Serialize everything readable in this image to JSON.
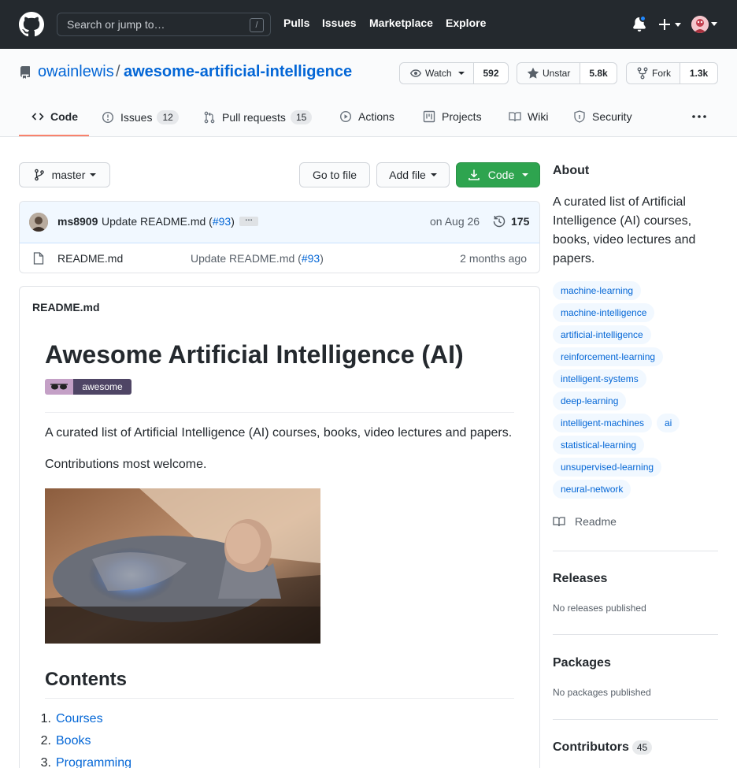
{
  "topnav": {
    "search_placeholder": "Search or jump to…",
    "slash_key": "/",
    "links": [
      "Pulls",
      "Issues",
      "Marketplace",
      "Explore"
    ]
  },
  "repo": {
    "owner": "owainlewis",
    "separator": "/",
    "name": "awesome-artificial-intelligence",
    "watch_label": "Watch",
    "watch_count": "592",
    "star_label": "Unstar",
    "star_count": "5.8k",
    "fork_label": "Fork",
    "fork_count": "1.3k"
  },
  "tabs": [
    {
      "label": "Code",
      "icon": "code-icon"
    },
    {
      "label": "Issues",
      "counter": "12",
      "icon": "issue-icon"
    },
    {
      "label": "Pull requests",
      "counter": "15",
      "icon": "pull-request-icon"
    },
    {
      "label": "Actions",
      "icon": "play-icon"
    },
    {
      "label": "Projects",
      "icon": "project-icon"
    },
    {
      "label": "Wiki",
      "icon": "book-icon"
    },
    {
      "label": "Security",
      "icon": "shield-icon"
    }
  ],
  "toolbar": {
    "branch": "master",
    "go_to_file": "Go to file",
    "add_file": "Add file",
    "code": "Code"
  },
  "commit": {
    "author": "ms8909",
    "message_prefix": "Update README.md (",
    "pr_link": "#93",
    "message_suffix": ")",
    "ellipsis": "…",
    "date": "on Aug 26",
    "count": "175"
  },
  "files": [
    {
      "name": "README.md",
      "message_prefix": "Update README.md (",
      "pr_link": "#93",
      "message_suffix": ")",
      "age": "2 months ago"
    }
  ],
  "readme": {
    "file_title": "README.md",
    "heading": "Awesome Artificial Intelligence (AI)",
    "badge_text": "awesome",
    "paragraph1": "A curated list of Artificial Intelligence (AI) courses, books, video lectures and papers.",
    "paragraph2": "Contributions most welcome.",
    "contents_heading": "Contents",
    "toc": [
      {
        "n": "1.",
        "label": "Courses"
      },
      {
        "n": "2.",
        "label": "Books"
      },
      {
        "n": "3.",
        "label": "Programming"
      }
    ]
  },
  "sidebar": {
    "about_title": "About",
    "description": "A curated list of Artificial Intelligence (AI) courses, books, video lectures and papers.",
    "topics": [
      "machine-learning",
      "machine-intelligence",
      "artificial-intelligence",
      "reinforcement-learning",
      "intelligent-systems",
      "deep-learning",
      "intelligent-machines",
      "ai",
      "statistical-learning",
      "unsupervised-learning",
      "neural-network"
    ],
    "readme_label": "Readme",
    "releases_title": "Releases",
    "releases_sub": "No releases published",
    "packages_title": "Packages",
    "packages_sub": "No packages published",
    "contributors_title": "Contributors",
    "contributors_count": "45"
  },
  "colors": {
    "nav_bg": "#24292e",
    "link": "#0366d6",
    "green": "#2ea44f",
    "tab_accent": "#f9826c",
    "notification_dot": "#2188ff"
  }
}
